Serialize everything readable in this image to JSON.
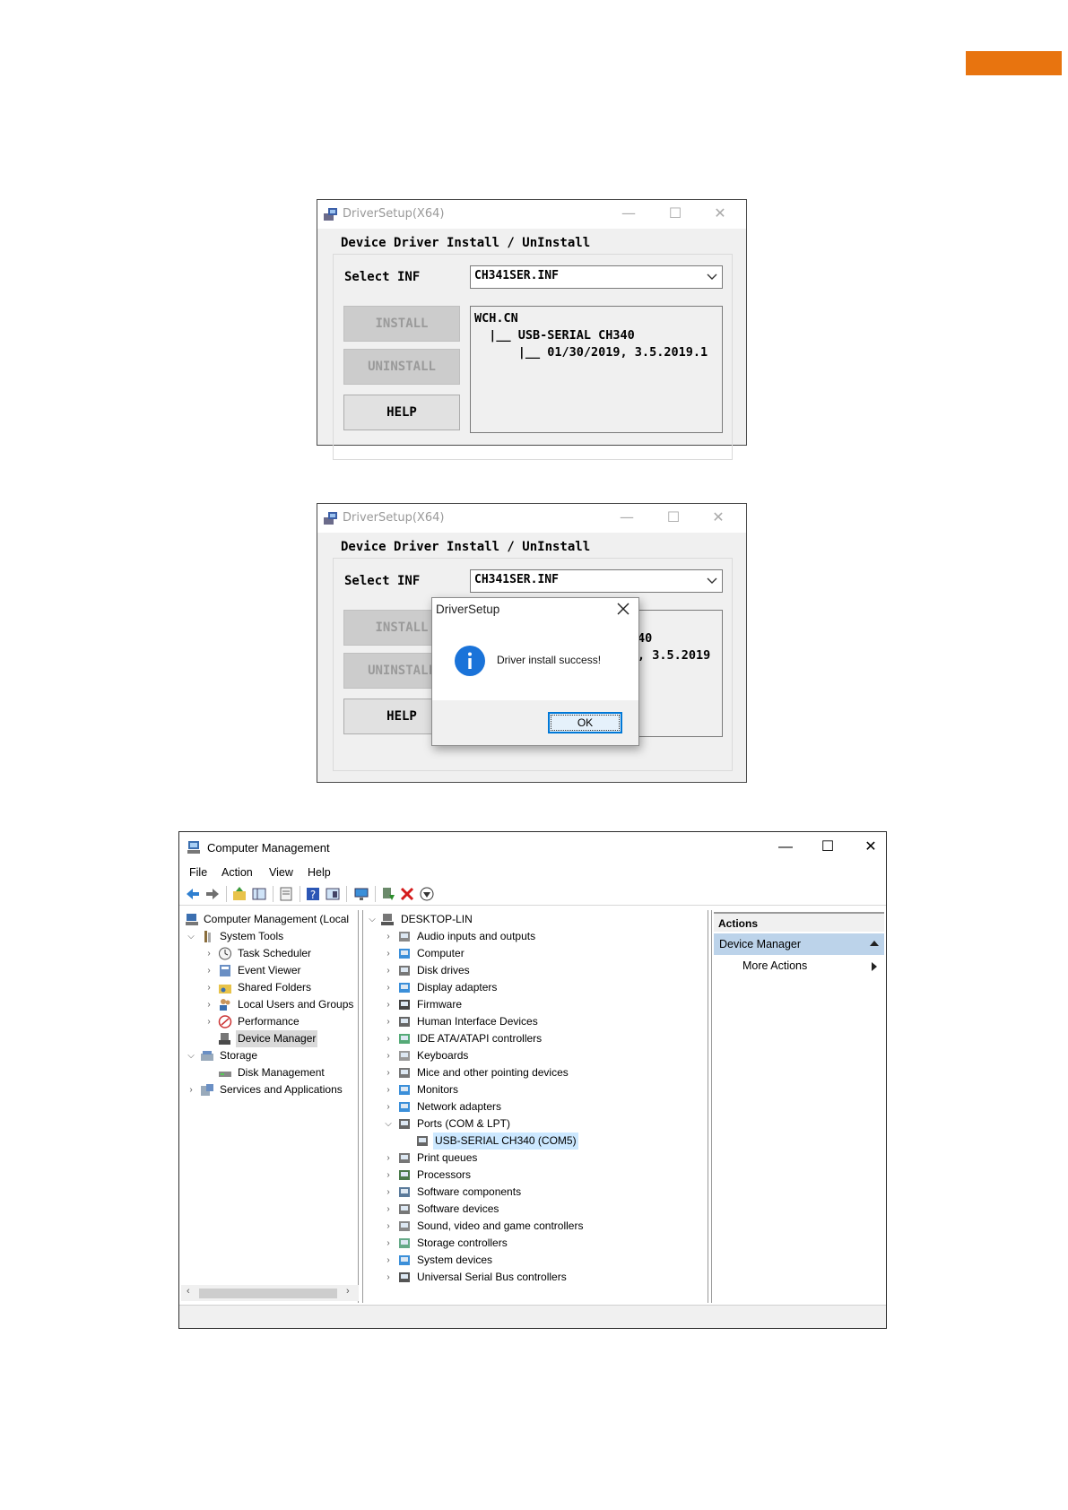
{
  "window1": {
    "title": "DriverSetup(X64)",
    "heading": "Device Driver Install / UnInstall",
    "select_label": "Select INF",
    "select_value": "CH341SER.INF",
    "buttons": {
      "install": "INSTALL",
      "uninstall": "UNINSTALL",
      "help": "HELP"
    },
    "info_lines": [
      "WCH.CN",
      "  |__ USB-SERIAL CH340",
      "      |__ 01/30/2019, 3.5.2019.1"
    ]
  },
  "window2": {
    "title": "DriverSetup(X64)",
    "heading": "Device Driver Install / UnInstall",
    "select_label": "Select INF",
    "select_value": "CH341SER.INF",
    "buttons": {
      "install": "INSTALL",
      "uninstall": "UNINSTALL",
      "help": "HELP"
    },
    "info_partial": [
      "40",
      ", 3.5.2019"
    ],
    "dialog": {
      "title": "DriverSetup",
      "message": "Driver install success!",
      "ok": "OK"
    }
  },
  "computer_management": {
    "title": "Computer Management",
    "menu": [
      "File",
      "Action",
      "View",
      "Help"
    ],
    "left_tree": {
      "root": "Computer Management (Local",
      "system_tools": "System Tools",
      "task_scheduler": "Task Scheduler",
      "event_viewer": "Event Viewer",
      "shared_folders": "Shared Folders",
      "local_users": "Local Users and Groups",
      "performance": "Performance",
      "device_manager": "Device Manager",
      "storage": "Storage",
      "disk_management": "Disk Management",
      "services": "Services and Applications"
    },
    "device_tree": {
      "root": "DESKTOP-LIN",
      "audio": "Audio inputs and outputs",
      "computer": "Computer",
      "disk_drives": "Disk drives",
      "display_adapters": "Display adapters",
      "firmware": "Firmware",
      "hid": "Human Interface Devices",
      "ide": "IDE ATA/ATAPI controllers",
      "keyboards": "Keyboards",
      "mice": "Mice and other pointing devices",
      "monitors": "Monitors",
      "network": "Network adapters",
      "ports": "Ports (COM & LPT)",
      "usb_serial": "USB-SERIAL CH340 (COM5)",
      "print_queues": "Print queues",
      "processors": "Processors",
      "software_components": "Software components",
      "software_devices": "Software devices",
      "sound": "Sound, video and game controllers",
      "storage_controllers": "Storage controllers",
      "system_devices": "System devices",
      "usb_controllers": "Universal Serial Bus controllers"
    },
    "actions": {
      "header": "Actions",
      "section": "Device Manager",
      "more": "More Actions"
    }
  },
  "colors": {
    "accent_orange": "#e8740f",
    "selection_blue": "#cce8ff",
    "info_blue": "#1a73d9"
  }
}
